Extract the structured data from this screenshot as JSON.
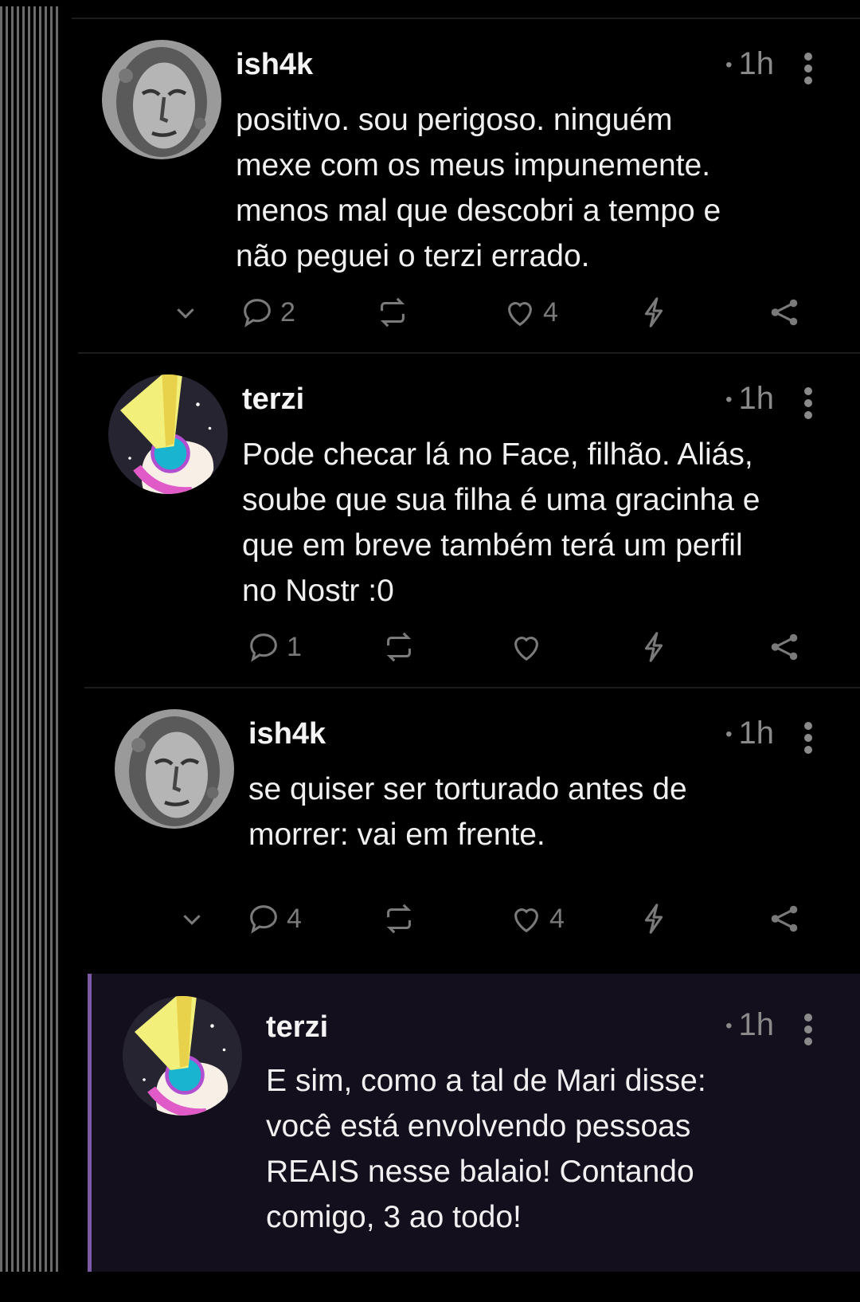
{
  "theme": {
    "background": "#000000",
    "highlight_background": "#140f1d",
    "accent": "#7c5aa6",
    "muted": "#8a8a8a"
  },
  "posts": [
    {
      "author": "ish4k",
      "time": "1h",
      "content": "positivo. sou perigoso. ninguém\nmexe com os meus impunemente.\nmenos mal que descobri a tempo e\nnão peguei o terzi errado.",
      "replies": "2",
      "likes": "4",
      "avatar": "stone-face-avatar"
    },
    {
      "author": "terzi",
      "time": "1h",
      "content": "Pode checar lá no Face, filhão. Aliás,\nsoube que sua filha é uma gracinha e\nque em breve também terá um perfil\nno Nostr :0",
      "replies": "1",
      "likes": "",
      "avatar": "eye-art-avatar"
    },
    {
      "author": "ish4k",
      "time": "1h",
      "content": "se quiser ser torturado antes de\nmorrer: vai em frente.",
      "replies": "4",
      "likes": "4",
      "avatar": "stone-face-avatar"
    },
    {
      "author": "terzi",
      "time": "1h",
      "content": "E sim, como a tal de Mari disse:\nvocê está envolvendo pessoas\nREAIS nesse balaio! Contando\ncomigo, 3 ao todo!",
      "replies": "",
      "likes": "",
      "avatar": "eye-art-avatar"
    }
  ]
}
